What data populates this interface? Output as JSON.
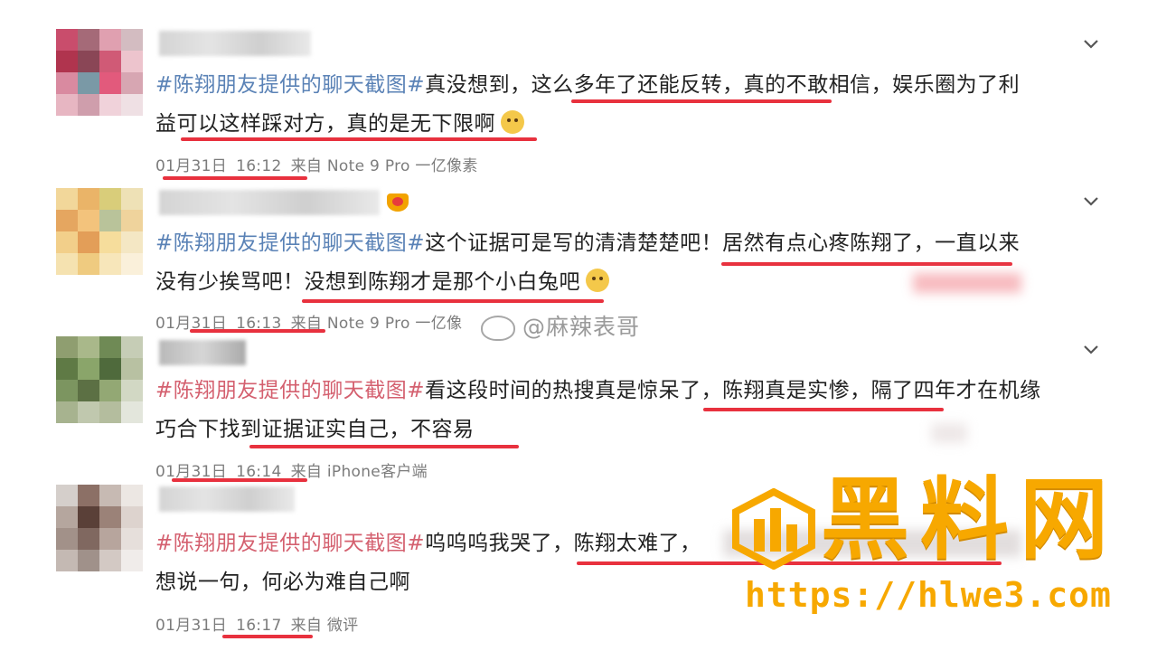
{
  "posts": [
    {
      "hashtag": "#陈翔朋友提供的聊天截图",
      "hash_close": "#",
      "text_line1": "真没想到，这么多年了还能反转，真的不敢相信，娱乐圈为了利",
      "text_line2": "益可以这样踩对方，真的是无下限啊",
      "date": "01月31日",
      "time": "16:12",
      "source": "来自 Note 9 Pro 一亿像素"
    },
    {
      "hashtag": "#陈翔朋友提供的聊天截图",
      "hash_close": "#",
      "text_line1": "这个证据可是写的清清楚楚吧！居然有点心疼陈翔了，一直以来",
      "text_line2": "没有少挨骂吧！没想到陈翔才是那个小白兔吧",
      "date": "01月31日",
      "time": "16:13",
      "source": "来自 Note 9 Pro 一亿像"
    },
    {
      "hashtag": "#陈翔朋友提供的聊天截图",
      "hash_close": "#",
      "text_line1": "看这段时间的热搜真是惊呆了，陈翔真是实惨，隔了四年才在机缘",
      "text_line2": "巧合下找到证据证实自己，不容易",
      "date": "01月31日",
      "time": "16:14",
      "source": "来自 iPhone客户端"
    },
    {
      "hashtag": "#陈翔朋友提供的聊天截图",
      "hash_close": "#",
      "text_line1": "呜呜呜我哭了，陈翔太难了，",
      "text_line2": "想说一句，何必为难自己啊",
      "date": "01月31日",
      "time": "16:17",
      "source": "来自 微评"
    }
  ],
  "weibo_watermark": "@麻辣表哥",
  "site_watermark": {
    "title": "黑料网",
    "url": "https://hlwe3.com"
  },
  "colors": {
    "hashtag_blue": "#5a82b6",
    "hashtag_red": "#d4606f",
    "underline_red": "#e8313e",
    "watermark_orange": "#f7a800"
  },
  "icons": {
    "expand": "chevron-down-icon",
    "emoji": "emoji-icon",
    "vip": "crown-icon",
    "weibo": "weibo-logo-icon"
  }
}
